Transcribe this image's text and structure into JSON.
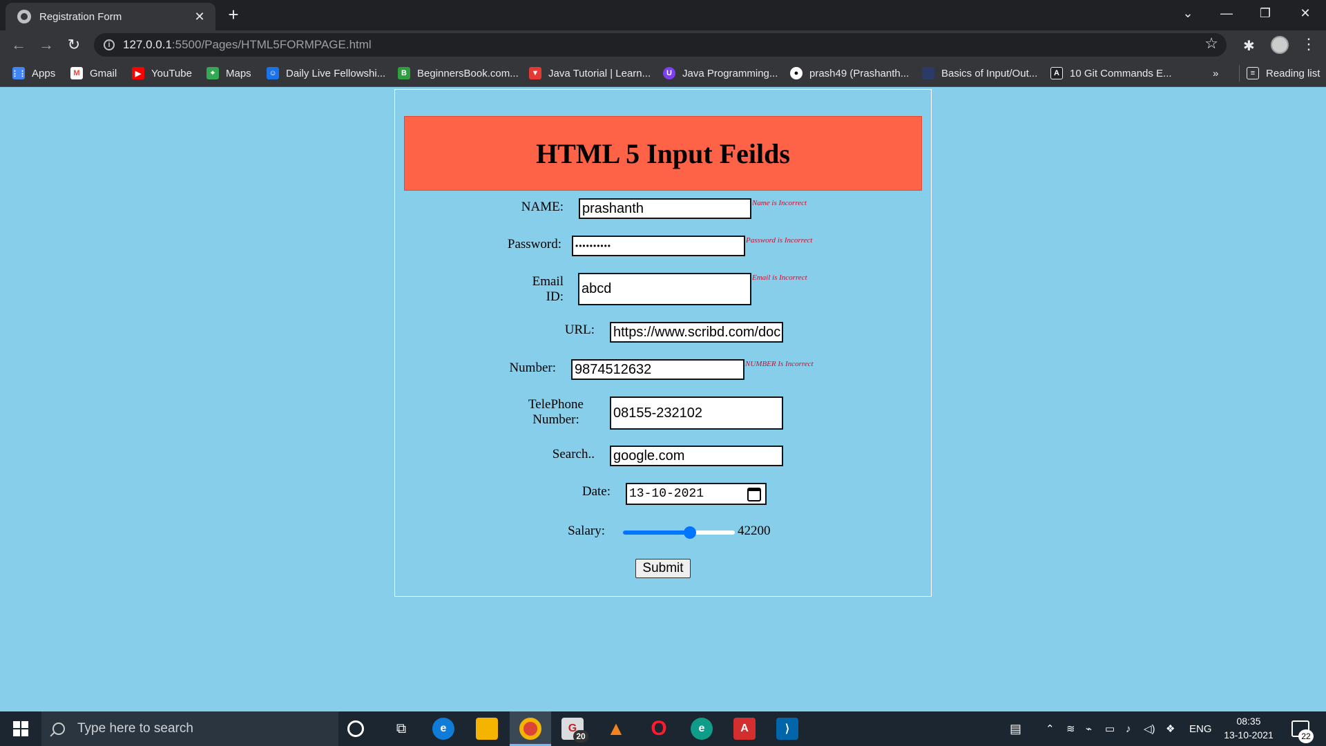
{
  "browser": {
    "tab_title": "Registration Form",
    "url_host": "127.0.0.1",
    "url_path": ":5500/Pages/HTML5FORMPAGE.html",
    "bookmarks": [
      {
        "label": "Apps",
        "color": "#4285f4"
      },
      {
        "label": "Gmail",
        "color": "#ea4335"
      },
      {
        "label": "YouTube",
        "color": "#ff0000"
      },
      {
        "label": "Maps",
        "color": "#34a853"
      },
      {
        "label": "Daily Live Fellowshi...",
        "color": "#1a73e8"
      },
      {
        "label": "BeginnersBook.com...",
        "color": "#2e9e3f"
      },
      {
        "label": "Java Tutorial | Learn...",
        "color": "#e53935"
      },
      {
        "label": "Java Programming...",
        "color": "#7e3ff2"
      },
      {
        "label": "prash49 (Prashanth...",
        "color": "#ffffff"
      },
      {
        "label": "Basics of Input/Out...",
        "color": "#2b3a67"
      },
      {
        "label": "10 Git Commands E...",
        "color": "#202124"
      }
    ],
    "more_bookmarks": "»",
    "reading_list": "Reading list"
  },
  "form": {
    "heading": "HTML 5 Input Feilds",
    "name": {
      "label": "NAME:",
      "value": "prashanth",
      "error": "Name is Incorrect"
    },
    "password": {
      "label": "Password:",
      "masked": "••••••••••",
      "error": "Password is Incorrect"
    },
    "email": {
      "label_line1": "Email",
      "label_line2": "ID:",
      "value": "abcd",
      "error": "Email is Incorrect"
    },
    "url": {
      "label": "URL:",
      "value": "https://www.scribd.com/doc"
    },
    "number": {
      "label": "Number:",
      "value": "9874512632",
      "error": "NUMBER Is Incorrect"
    },
    "telephone": {
      "label_line1": "TelePhone",
      "label_line2": "Number:",
      "value": "08155-232102"
    },
    "search": {
      "label": "Search..",
      "value": "google.com"
    },
    "date": {
      "label": "Date:",
      "value": "13-10-2021"
    },
    "salary": {
      "label": "Salary:",
      "value": "42200",
      "level": 0.6
    },
    "submit_label": "Submit"
  },
  "taskbar": {
    "search_placeholder": "Type here to search",
    "badge_count": "20",
    "language": "ENG",
    "time": "08:35",
    "date": "13-10-2021",
    "notification_count": "22"
  }
}
